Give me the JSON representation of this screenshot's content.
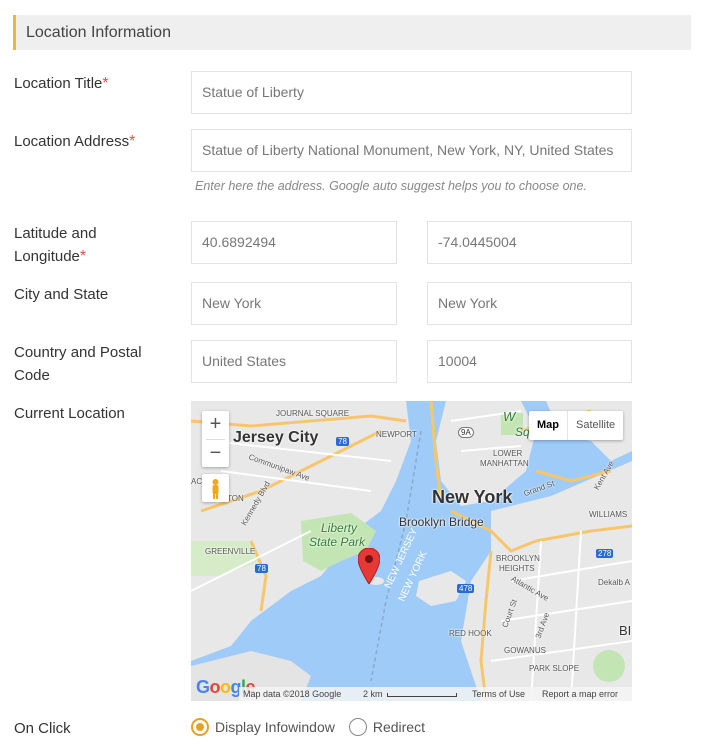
{
  "section": {
    "title": "Location Information"
  },
  "labels": {
    "location_title": "Location Title",
    "location_address": "Location Address",
    "lat_lng_line1": "Latitude and",
    "lat_lng_line2": "Longitude",
    "city_state": "City and State",
    "country_postal_line1": "Country and Postal",
    "country_postal_line2": "Code",
    "current_location": "Current Location",
    "on_click": "On Click",
    "required_mark": "*"
  },
  "fields": {
    "location_title": "Statue of Liberty",
    "location_address": "Statue of Liberty National Monument, New York, NY, United States",
    "latitude": "40.6892494",
    "longitude": "-74.0445004",
    "city": "New York",
    "state": "New York",
    "country": "United States",
    "postal_code": "10004"
  },
  "hints": {
    "address": "Enter here the address. Google auto suggest helps you to choose one."
  },
  "map": {
    "zoom_in": "+",
    "zoom_out": "−",
    "type_map": "Map",
    "type_satellite": "Satellite",
    "footer_data": "Map data ©2018 Google",
    "footer_scale": "2 km",
    "footer_terms": "Terms of Use",
    "footer_report": "Report a map error",
    "logo": [
      "G",
      "o",
      "o",
      "g",
      "l",
      "e"
    ],
    "places": {
      "jersey_city": "Jersey City",
      "new_york": "New York",
      "brooklyn_bridge": "Brooklyn Bridge",
      "liberty_park_1": "Liberty",
      "liberty_park_2": "State Park",
      "journal_square": "JOURNAL SQUARE",
      "newport": "NEWPORT",
      "lower_manhattan_1": "LOWER",
      "lower_manhattan_2": "MANHATTAN",
      "communipaw": "Communipaw Ave",
      "kennedy": "Kennedy Blvd",
      "greenville": "GREENVILLE",
      "new_jersey": "NEW JERSEY",
      "new_york_water": "NEW YORK",
      "brooklyn_heights_1": "BROOKLYN",
      "brooklyn_heights_2": "HEIGHTS",
      "red_hook": "RED HOOK",
      "gowanus": "GOWANUS",
      "park_slope": "PARK SLOPE",
      "williams": "WILLIAMS",
      "atlantic": "Atlantic Ave",
      "court_st": "Court St",
      "third_ave": "3rd Ave",
      "grand_st": "Grand St",
      "kent_ave": "Kent Ave",
      "dekalb": "Dekalb A",
      "jack": "ACK",
      "ton": "TON",
      "route_78a": "78",
      "route_78b": "78",
      "route_9a": "9A",
      "route_278": "278",
      "route_478": "478",
      "wa_1": "W",
      "wa_2": "Sq",
      "bi": "BI"
    }
  },
  "on_click": {
    "option_infowindow": "Display Infowindow",
    "option_redirect": "Redirect",
    "selected": "Display Infowindow"
  },
  "colors": {
    "accent": "#e9a21f",
    "required": "#d9534f",
    "water": "#9ecbf8",
    "land": "#e8e8e8",
    "park": "#c3e5b3",
    "pin": "#e53935"
  }
}
